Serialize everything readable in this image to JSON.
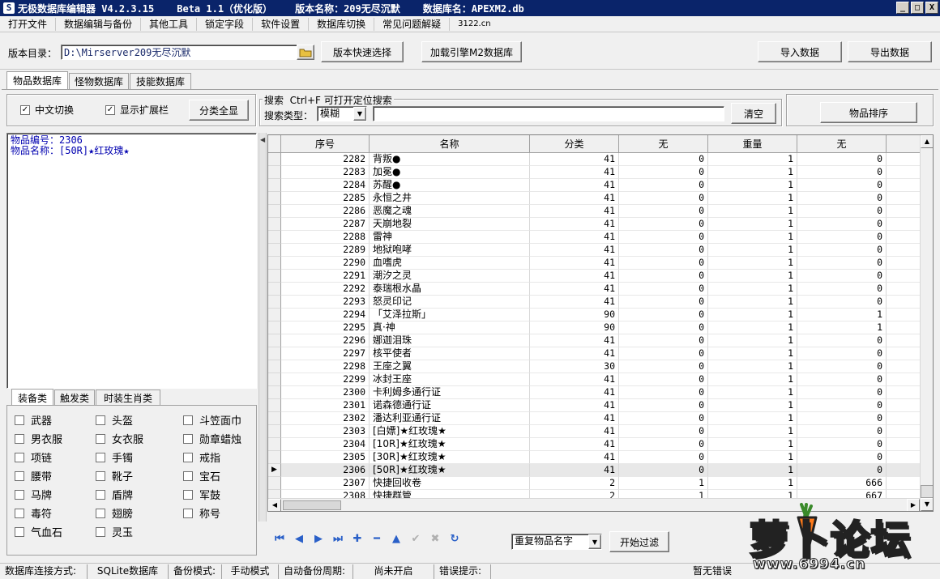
{
  "titlebar": {
    "app_name": "无极数据库编辑器 V4.2.3.15",
    "beta": "Beta 1.1（优化版）",
    "version_name": "版本名称：209无尽沉默",
    "db_name": "数据库名：APEXM2.db",
    "btn_min": "_",
    "btn_max": "□",
    "btn_close": "X"
  },
  "menu": [
    "打开文件",
    "数据编辑与备份",
    "其他工具",
    "锁定字段",
    "软件设置",
    "数据库切换",
    "常见问题解疑",
    "3122.cn"
  ],
  "toolbar": {
    "dir_label": "版本目录：",
    "dir_value": "D:\\Mirserver209无尽沉默",
    "quick_select": "版本快速选择",
    "load_engine": "加载引擎M2数据库",
    "import": "导入数据",
    "export": "导出数据"
  },
  "tabs": [
    "物品数据库",
    "怪物数据库",
    "技能数据库"
  ],
  "options": {
    "cn_switch": "中文切换",
    "show_ext": "显示扩展栏",
    "show_all": "分类全显"
  },
  "search": {
    "group_label": "搜索  Ctrl+F 可打开定位搜索",
    "type_label": "搜索类型：",
    "type_value": "模糊",
    "query": "",
    "clear": "清空",
    "sort": "物品排序"
  },
  "info": {
    "line1": "物品编号：2306",
    "line2": "物品名称：[50R]★红玫瑰★"
  },
  "category_tabs": [
    "装备类",
    "触发类",
    "时装生肖类"
  ],
  "categories": [
    [
      "武器",
      "头盔",
      "斗笠面巾"
    ],
    [
      "男衣服",
      "女衣服",
      "勋章蜡烛"
    ],
    [
      "项链",
      "手镯",
      "戒指"
    ],
    [
      "腰带",
      "靴子",
      "宝石"
    ],
    [
      "马牌",
      "盾牌",
      "军鼓"
    ],
    [
      "毒符",
      "翅膀",
      "称号"
    ],
    [
      "气血石",
      "灵玉",
      ""
    ]
  ],
  "grid": {
    "columns": [
      "序号",
      "名称",
      "分类",
      "无",
      "重量",
      "无"
    ],
    "selected_index": 24,
    "rows": [
      [
        "2282",
        "背叛●",
        "41",
        "0",
        "1",
        "0"
      ],
      [
        "2283",
        "加冕●",
        "41",
        "0",
        "1",
        "0"
      ],
      [
        "2284",
        "苏醒●",
        "41",
        "0",
        "1",
        "0"
      ],
      [
        "2285",
        "永恒之井",
        "41",
        "0",
        "1",
        "0"
      ],
      [
        "2286",
        "恶魔之魂",
        "41",
        "0",
        "1",
        "0"
      ],
      [
        "2287",
        "天崩地裂",
        "41",
        "0",
        "1",
        "0"
      ],
      [
        "2288",
        "雷神",
        "41",
        "0",
        "1",
        "0"
      ],
      [
        "2289",
        "地狱咆哮",
        "41",
        "0",
        "1",
        "0"
      ],
      [
        "2290",
        "血嗜虎",
        "41",
        "0",
        "1",
        "0"
      ],
      [
        "2291",
        "潮汐之灵",
        "41",
        "0",
        "1",
        "0"
      ],
      [
        "2292",
        "泰瑞根水晶",
        "41",
        "0",
        "1",
        "0"
      ],
      [
        "2293",
        "怒灵印记",
        "41",
        "0",
        "1",
        "0"
      ],
      [
        "2294",
        "「艾泽拉斯」",
        "90",
        "0",
        "1",
        "1"
      ],
      [
        "2295",
        "真·神",
        "90",
        "0",
        "1",
        "1"
      ],
      [
        "2296",
        "娜迦泪珠",
        "41",
        "0",
        "1",
        "0"
      ],
      [
        "2297",
        "核平使者",
        "41",
        "0",
        "1",
        "0"
      ],
      [
        "2298",
        "王座之翼",
        "30",
        "0",
        "1",
        "0"
      ],
      [
        "2299",
        "冰封王座",
        "41",
        "0",
        "1",
        "0"
      ],
      [
        "2300",
        "卡利姆多通行证",
        "41",
        "0",
        "1",
        "0"
      ],
      [
        "2301",
        "诺森德通行证",
        "41",
        "0",
        "1",
        "0"
      ],
      [
        "2302",
        "潘达利亚通行证",
        "41",
        "0",
        "1",
        "0"
      ],
      [
        "2303",
        "[白嫖]★红玫瑰★",
        "41",
        "0",
        "1",
        "0"
      ],
      [
        "2304",
        "[10R]★红玫瑰★",
        "41",
        "0",
        "1",
        "0"
      ],
      [
        "2305",
        "[30R]★红玫瑰★",
        "41",
        "0",
        "1",
        "0"
      ],
      [
        "2306",
        "[50R]★红玫瑰★",
        "41",
        "0",
        "1",
        "0"
      ],
      [
        "2307",
        "快捷回收卷",
        "2",
        "1",
        "1",
        "666"
      ],
      [
        "2308",
        "快捷群管",
        "2",
        "1",
        "1",
        "667"
      ]
    ]
  },
  "filter": {
    "select_value": "重复物品名字",
    "start": "开始过滤"
  },
  "status": {
    "conn_label": "数据库连接方式:",
    "conn_value": "SQLite数据库",
    "backup_label": "备份模式:",
    "backup_value": "手动模式",
    "auto_label": "自动备份周期:",
    "auto_value": "尚未开启",
    "err_label": "错误提示:",
    "err_value": "暂无错误"
  },
  "logo": {
    "text": "萝卜论坛",
    "url": "www.6994.cn"
  },
  "colors": {
    "titlebar": "#0a246a",
    "info_text": "#0000b0",
    "nav_icon": "#2a60c8"
  }
}
